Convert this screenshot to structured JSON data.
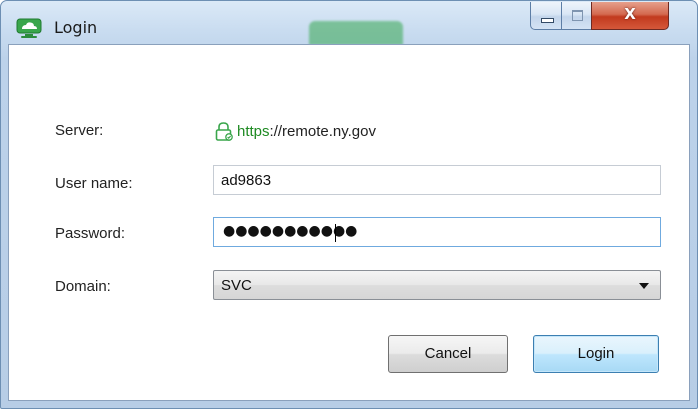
{
  "window": {
    "title": "Login",
    "icon": "monitor-cloud-icon",
    "controls": {
      "minimize": "minimize-icon",
      "maximize": "maximize-icon",
      "close": "X"
    }
  },
  "form": {
    "server": {
      "label": "Server:",
      "scheme": "https",
      "host": "://remote.ny.gov",
      "icon": "lock-icon"
    },
    "username": {
      "label": "User name:",
      "value": "ad9863"
    },
    "password": {
      "label": "Password:",
      "masked_value": "●●●●●●●●●●●"
    },
    "domain": {
      "label": "Domain:",
      "selected": "SVC"
    }
  },
  "buttons": {
    "cancel": "Cancel",
    "login": "Login"
  },
  "colors": {
    "accent_green": "#1e8a22",
    "focus_border": "#6faadf",
    "close_red": "#c23a1e",
    "frame_blue": "#bcd2ea"
  }
}
